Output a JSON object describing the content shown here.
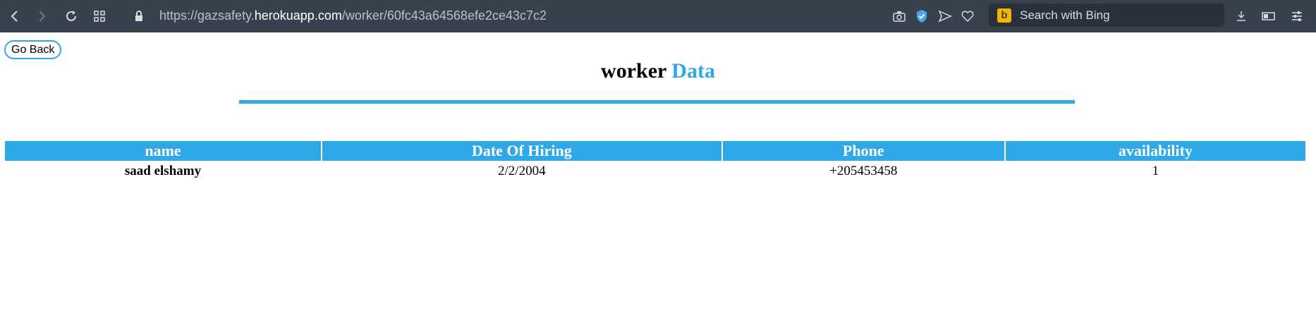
{
  "browser": {
    "url_prefix": "https://gazsafety.",
    "url_host": "herokuapp.com",
    "url_path": "/worker/60fc43a64568efe2ce43c7c2",
    "search_placeholder": "Search with Bing",
    "search_engine_icon": "bing-icon"
  },
  "page": {
    "back_label": "Go Back",
    "title_main": "worker",
    "title_accent": "Data",
    "accent_color": "#2ea8e6"
  },
  "table": {
    "headers": [
      "name",
      "Date Of Hiring",
      "Phone",
      "availability"
    ],
    "rows": [
      {
        "name": "saad elshamy",
        "date_of_hiring": "2/2/2004",
        "phone": "+205453458",
        "availability": "1"
      }
    ]
  }
}
